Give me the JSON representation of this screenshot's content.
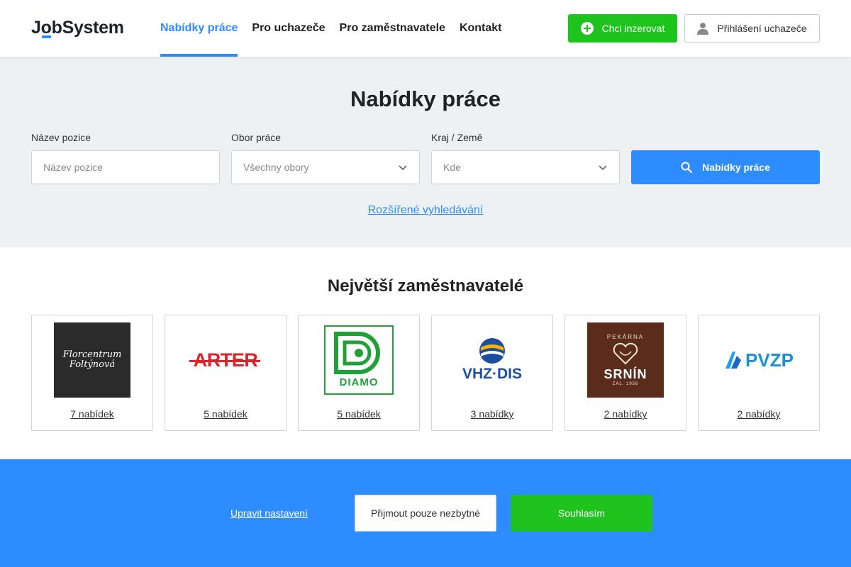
{
  "header": {
    "logo": {
      "part1": "J",
      "part2": "o",
      "part3": "bSystem"
    },
    "nav": [
      {
        "label": "Nabídky práce",
        "active": true
      },
      {
        "label": "Pro uchazeče",
        "active": false
      },
      {
        "label": "Pro zaměstnavatele",
        "active": false
      },
      {
        "label": "Kontakt",
        "active": false
      }
    ],
    "advertise_label": "Chci inzerovat",
    "login_label": "Přihlášení uchazeče"
  },
  "search": {
    "title": "Nabídky práce",
    "position_label": "Název pozice",
    "position_placeholder": "Název pozice",
    "field_label": "Obor práce",
    "field_value": "Všechny obory",
    "region_label": "Kraj / Země",
    "region_value": "Kde",
    "button_label": "Nabídky práce",
    "advanced_link": "Rozšířené vyhledávání"
  },
  "employers": {
    "title": "Největší zaměstnavatelé",
    "items": [
      {
        "name": "Florcentrum Foltýnová",
        "logo_line1": "Florcentrum",
        "logo_line2": "Foltýnová",
        "count": "7 nabídek"
      },
      {
        "name": "ARTER",
        "logo_text": "ARTER",
        "count": "5 nabídek"
      },
      {
        "name": "DIAMO",
        "logo_text": "DIAMO",
        "count": "5 nabídek"
      },
      {
        "name": "VHZ-DIS",
        "logo_text": "VHZ·DIS",
        "count": "3 nabídky"
      },
      {
        "name": "Pekárna Srnín",
        "logo_top": "PEKÁRNA",
        "logo_text": "SRNÍN",
        "logo_sub": "ZAL. 1956",
        "count": "2 nabídky"
      },
      {
        "name": "PVZP",
        "logo_text": "PVZP",
        "count": "2 nabídky"
      }
    ]
  },
  "cookies": {
    "settings_link": "Upravit nastavení",
    "necessary_button": "Přijmout pouze nezbytné",
    "agree_button": "Souhlasím"
  },
  "colors": {
    "primary": "#2d8cff",
    "success": "#1ec31e",
    "background_light": "#eef1f4"
  }
}
